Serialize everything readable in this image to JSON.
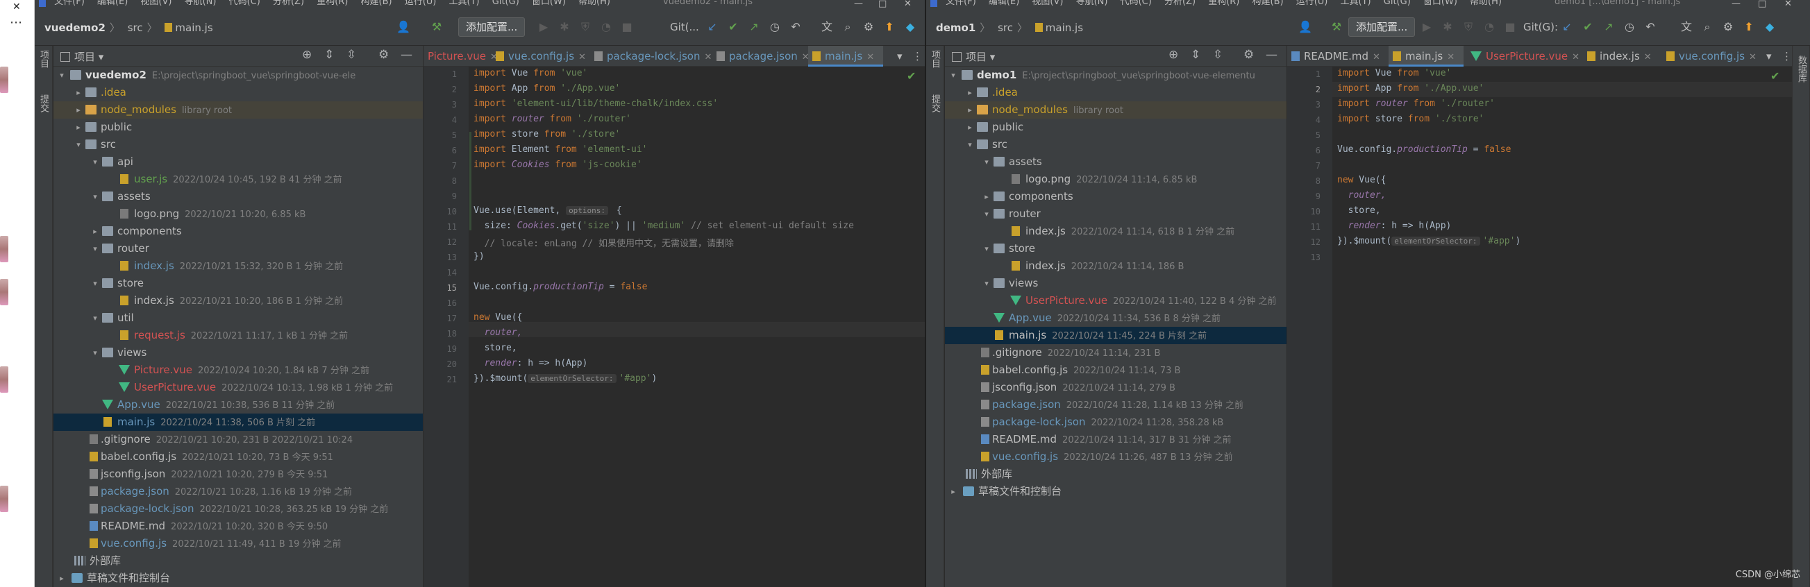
{
  "ide1": {
    "menu": [
      "文件(F)",
      "编辑(E)",
      "视图(V)",
      "导航(N)",
      "代码(C)",
      "分析(Z)",
      "重构(R)",
      "构建(B)",
      "运行(U)",
      "工具(T)",
      "Git(G)",
      "窗口(W)",
      "帮助(H)"
    ],
    "window_title": "vuedemo2 - main.js",
    "breadcrumb": [
      "vuedemo2",
      "src",
      "main.js"
    ],
    "run_config": "添加配置...",
    "git_label": "Git(...",
    "project_panel_title": "项目",
    "stripe_labels": [
      "项目",
      "提交"
    ],
    "tree": [
      {
        "label": "vuedemo2",
        "meta": "E:\\project\\springboot_vue\\springboot-vue-ele"
      },
      {
        "label": ".idea"
      },
      {
        "label": "node_modules",
        "meta": "library root"
      },
      {
        "label": "public"
      },
      {
        "label": "src"
      },
      {
        "label": "api"
      },
      {
        "label": "user.js",
        "meta": "2022/10/24 10:45, 192 B 41 分钟 之前"
      },
      {
        "label": "assets"
      },
      {
        "label": "logo.png",
        "meta": "2022/10/21 10:20, 6.85 kB"
      },
      {
        "label": "components"
      },
      {
        "label": "router"
      },
      {
        "label": "index.js",
        "meta": "2022/10/21 15:32, 320 B 1 分钟 之前"
      },
      {
        "label": "store"
      },
      {
        "label": "index.js",
        "meta": "2022/10/21 10:20, 186 B 1 分钟 之前"
      },
      {
        "label": "util"
      },
      {
        "label": "request.js",
        "meta": "2022/10/21 11:17, 1 kB 1 分钟 之前"
      },
      {
        "label": "views"
      },
      {
        "label": "Picture.vue",
        "meta": "2022/10/24 10:20, 1.84 kB 7 分钟 之前"
      },
      {
        "label": "UserPicture.vue",
        "meta": "2022/10/24 10:13, 1.98 kB 1 分钟 之前"
      },
      {
        "label": "App.vue",
        "meta": "2022/10/21 10:38, 536 B 11 分钟 之前"
      },
      {
        "label": "main.js",
        "meta": "2022/10/24 11:38, 506 B 片刻 之前"
      },
      {
        "label": ".gitignore",
        "meta": "2022/10/21 10:20, 231 B 2022/10/21 10:24"
      },
      {
        "label": "babel.config.js",
        "meta": "2022/10/21 10:20, 73 B 今天 9:51"
      },
      {
        "label": "jsconfig.json",
        "meta": "2022/10/21 10:20, 279 B 今天 9:51"
      },
      {
        "label": "package.json",
        "meta": "2022/10/21 10:28, 1.16 kB 19 分钟 之前"
      },
      {
        "label": "package-lock.json",
        "meta": "2022/10/21 10:28, 363.25 kB 19 分钟 之前"
      },
      {
        "label": "README.md",
        "meta": "2022/10/21 10:20, 320 B 今天 9:50"
      },
      {
        "label": "vue.config.js",
        "meta": "2022/10/21 11:49, 411 B 19 分钟 之前"
      },
      {
        "label": "外部库"
      },
      {
        "label": "草稿文件和控制台"
      }
    ],
    "tabs": [
      "Picture.vue",
      "vue.config.js",
      "package-lock.json",
      "package.json",
      "main.js"
    ],
    "line_numbers": [
      "1",
      "2",
      "3",
      "4",
      "5",
      "6",
      "7",
      "8",
      "9",
      "10",
      "11",
      "12",
      "13",
      "14",
      "15",
      "16",
      "17",
      "18",
      "19",
      "20",
      "21"
    ],
    "code": {
      "l1": [
        "import",
        " Vue ",
        "from",
        " 'vue'"
      ],
      "l2": [
        "import",
        " App ",
        "from",
        " './App.vue'"
      ],
      "l3": [
        "import",
        " 'element-ui/lib/theme-chalk/index.css'"
      ],
      "l4": [
        "import",
        " router ",
        "from",
        " './router'"
      ],
      "l5": [
        "import",
        " store ",
        "from",
        " './store'"
      ],
      "l6": [
        "import",
        " Element ",
        "from",
        " 'element-ui'"
      ],
      "l7": [
        "import",
        " Cookies ",
        "from",
        " 'js-cookie'"
      ],
      "l10a": "Vue.use(Element, ",
      "l10hint": "options:",
      "l10b": " {",
      "l11a": "  size: ",
      "l11b": "Cookies",
      "l11c": ".get(",
      "l11d": "'size'",
      "l11e": ") || ",
      "l11f": "'medium'",
      "l11g": " // set element-ui default size",
      "l12": "  // locale: enLang // 如果使用中文，无需设置，请删除",
      "l13": "})",
      "l15a": "Vue.config.",
      "l15b": "productionTip",
      "l15c": " = ",
      "l15d": "false",
      "l17a": "new",
      "l17b": " Vue({",
      "l18": "  router,",
      "l19": "  store,",
      "l20a": "  render",
      "l20b": ": h => h(App)",
      "l21a": "}).$mount(",
      "l21hint": "elementOrSelector:",
      "l21b": "'#app'",
      "l21c": ")"
    }
  },
  "ide2": {
    "menu": [
      "文件(F)",
      "编辑(E)",
      "视图(V)",
      "导航(N)",
      "代码(C)",
      "分析(Z)",
      "重构(R)",
      "构建(B)",
      "运行(U)",
      "工具(T)",
      "Git(G)",
      "窗口(W)",
      "帮助(H)"
    ],
    "window_title": "demo1 [...\\demo1] - main.js",
    "breadcrumb": [
      "demo1",
      "src",
      "main.js"
    ],
    "run_config": "添加配置...",
    "git_label": "Git(G):",
    "project_panel_title": "项目",
    "stripe_labels": [
      "项目",
      "提交"
    ],
    "right_stripe": "数据库",
    "tree": [
      {
        "label": "demo1",
        "meta": "E:\\project\\springboot_vue\\springboot-vue-elementu"
      },
      {
        "label": ".idea"
      },
      {
        "label": "node_modules",
        "meta": "library root"
      },
      {
        "label": "public"
      },
      {
        "label": "src"
      },
      {
        "label": "assets"
      },
      {
        "label": "logo.png",
        "meta": "2022/10/24 11:14, 6.85 kB"
      },
      {
        "label": "components"
      },
      {
        "label": "router"
      },
      {
        "label": "index.js",
        "meta": "2022/10/24 11:14, 618 B 1 分钟 之前"
      },
      {
        "label": "store"
      },
      {
        "label": "index.js",
        "meta": "2022/10/24 11:14, 186 B"
      },
      {
        "label": "views"
      },
      {
        "label": "UserPicture.vue",
        "meta": "2022/10/24 11:40, 122 B 4 分钟 之前"
      },
      {
        "label": "App.vue",
        "meta": "2022/10/24 11:34, 536 B 8 分钟 之前"
      },
      {
        "label": "main.js",
        "meta": "2022/10/24 11:45, 224 B 片刻 之前"
      },
      {
        "label": ".gitignore",
        "meta": "2022/10/24 11:14, 231 B"
      },
      {
        "label": "babel.config.js",
        "meta": "2022/10/24 11:14, 73 B"
      },
      {
        "label": "jsconfig.json",
        "meta": "2022/10/24 11:14, 279 B"
      },
      {
        "label": "package.json",
        "meta": "2022/10/24 11:28, 1.14 kB 13 分钟 之前"
      },
      {
        "label": "package-lock.json",
        "meta": "2022/10/24 11:28, 358.28 kB"
      },
      {
        "label": "README.md",
        "meta": "2022/10/24 11:14, 317 B 31 分钟 之前"
      },
      {
        "label": "vue.config.js",
        "meta": "2022/10/24 11:26, 487 B 13 分钟 之前"
      },
      {
        "label": "外部库"
      },
      {
        "label": "草稿文件和控制台"
      }
    ],
    "tabs": [
      "README.md",
      "main.js",
      "UserPicture.vue",
      "index.js",
      "vue.config.js"
    ],
    "line_numbers": [
      "1",
      "2",
      "3",
      "4",
      "5",
      "6",
      "7",
      "8",
      "9",
      "10",
      "11",
      "12",
      "13"
    ],
    "code": {
      "l1": [
        "import",
        " Vue ",
        "from",
        " 'vue'"
      ],
      "l2": [
        "import",
        " App ",
        "from",
        " './App.vue'"
      ],
      "l3": [
        "import",
        " router ",
        "from",
        " './router'"
      ],
      "l4": [
        "import",
        " store ",
        "from",
        " './store'"
      ],
      "l6a": "Vue.config.",
      "l6b": "productionTip",
      "l6c": " = ",
      "l6d": "false",
      "l8a": "new",
      "l8b": " Vue({",
      "l9": "  router,",
      "l10": "  store,",
      "l11a": "  render",
      "l11b": ": h => h(App)",
      "l12a": "}).$mount(",
      "l12hint": "elementOrSelector:",
      "l12b": "'#app'",
      "l12c": ")"
    }
  },
  "watermark": "CSDN @小绵芯",
  "colors": {
    "selection": "#0d293e",
    "tab_underline": "#4a88c7",
    "keyword": "#cc7832",
    "string": "#6a8759"
  }
}
